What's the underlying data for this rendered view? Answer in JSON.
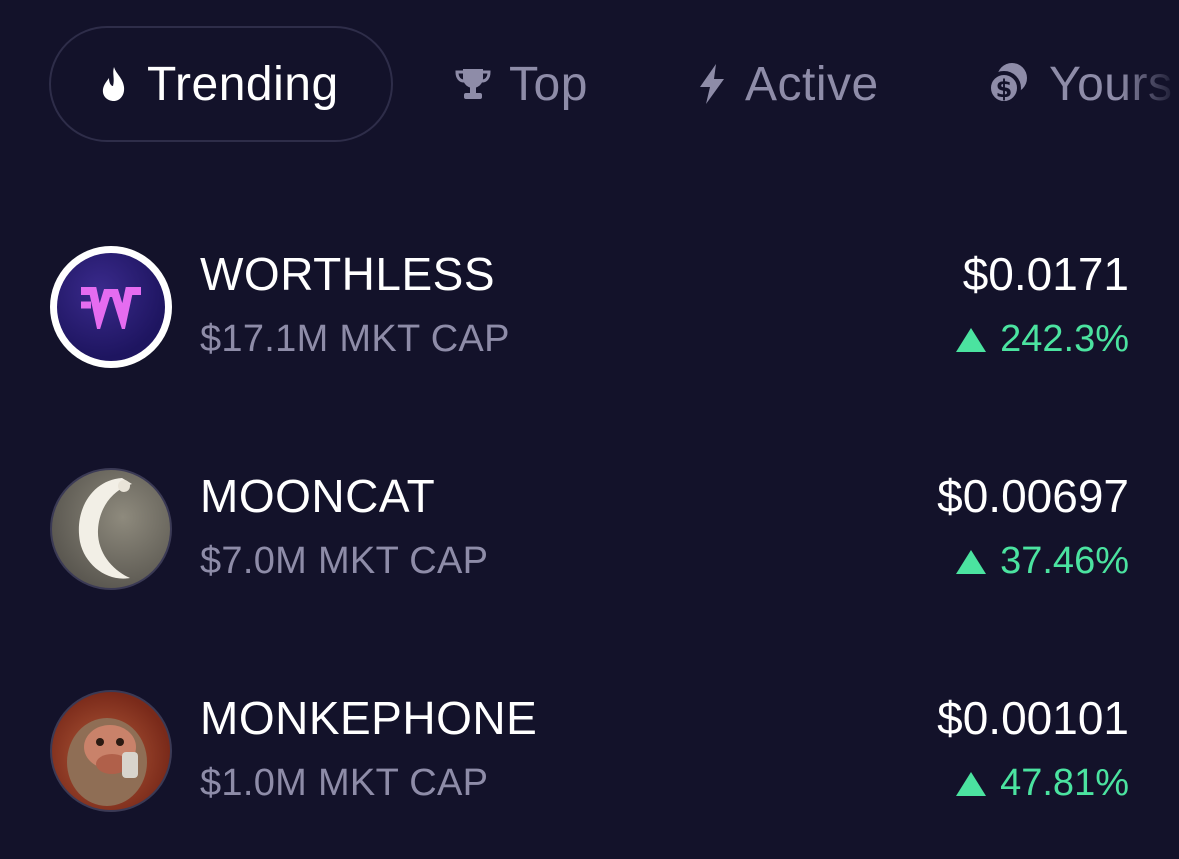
{
  "tabs": [
    {
      "label": "Trending",
      "icon": "flame-icon",
      "active": true
    },
    {
      "label": "Top",
      "icon": "trophy-icon",
      "active": false
    },
    {
      "label": "Active",
      "icon": "lightning-icon",
      "active": false
    },
    {
      "label": "Yours",
      "icon": "coins-icon",
      "active": false
    }
  ],
  "tokens": [
    {
      "name": "WORTHLESS",
      "mkt_cap": "$17.1M MKT CAP",
      "price": "$0.0171",
      "change": "242.3%",
      "direction": "up",
      "avatar": "worthless-logo"
    },
    {
      "name": "MOONCAT",
      "mkt_cap": "$7.0M MKT CAP",
      "price": "$0.00697",
      "change": "37.46%",
      "direction": "up",
      "avatar": "mooncat-image"
    },
    {
      "name": "MONKEPHONE",
      "mkt_cap": "$1.0M MKT CAP",
      "price": "$0.00101",
      "change": "47.81%",
      "direction": "up",
      "avatar": "monkephone-image"
    }
  ],
  "colors": {
    "background": "#13122a",
    "positive": "#4be3a0",
    "muted": "#8e8ca8",
    "worthless_logo": "#e56cf0"
  }
}
